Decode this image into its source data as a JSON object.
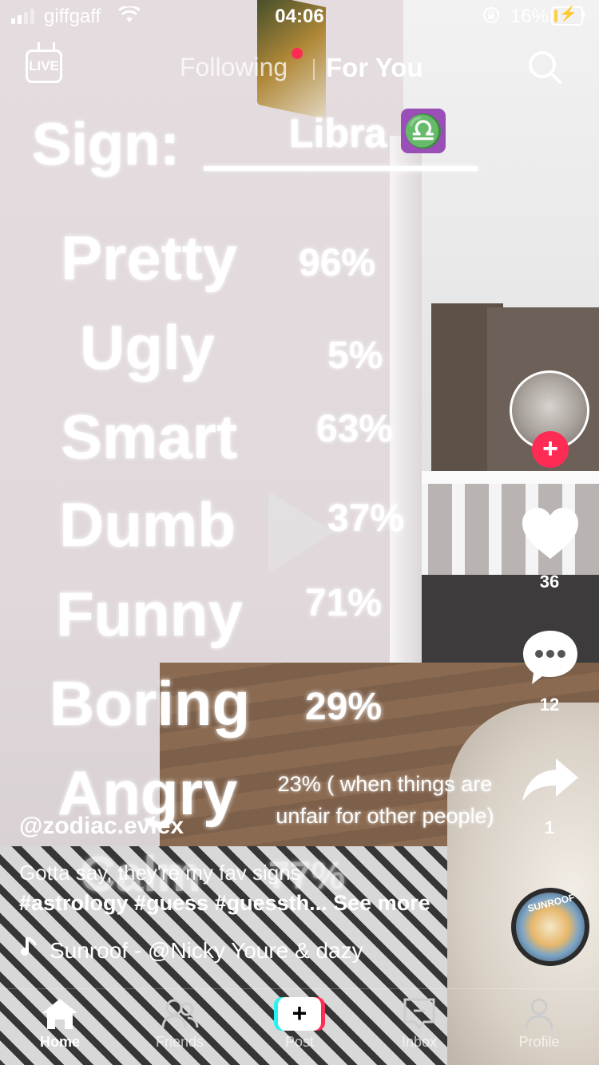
{
  "status_bar": {
    "carrier": "giffgaff",
    "time": "04:06",
    "battery_percent": "16%",
    "battery_level": 0.16,
    "battery_color": "#f7d14b"
  },
  "top_nav": {
    "live_label": "LIVE",
    "tab_following": "Following",
    "tab_for_you": "For You",
    "search_icon": "search-icon"
  },
  "video_overlay": {
    "sign_label": "Sign:",
    "sign_value": "Libra",
    "libra_symbol": "♎",
    "traits": [
      {
        "name": "Pretty",
        "percent": "96%"
      },
      {
        "name": "Ugly",
        "percent": "5%"
      },
      {
        "name": "Smart",
        "percent": "63%"
      },
      {
        "name": "Dumb",
        "percent": "37%"
      },
      {
        "name": "Funny",
        "percent": "71%"
      },
      {
        "name": "Boring",
        "percent": "29%"
      },
      {
        "name": "Angry",
        "percent_line1": "23% ( when things are",
        "percent_line2": "unfair for other people)"
      },
      {
        "name": "Calm",
        "percent": "77%"
      }
    ]
  },
  "right_rail": {
    "follow_symbol": "+",
    "likes": "36",
    "comments": "12",
    "shares": "1",
    "disc_label": "SUNROOF"
  },
  "caption": {
    "username": "@zodiac.eviex",
    "text": "Gotta say, they're my fav signs",
    "hashtags": "#astrology #guess #guessth...",
    "see_more": "See more",
    "sound": "Sunroof - @Nicky Youre & dazy"
  },
  "bottom_nav": {
    "home": "Home",
    "friends": "Friends",
    "post": "Post",
    "post_symbol": "+",
    "inbox": "Inbox",
    "profile": "Profile"
  },
  "colors": {
    "accent_red": "#fe2c55",
    "accent_cyan": "#25f4ee",
    "libra_purple": "#9a4fb6"
  }
}
